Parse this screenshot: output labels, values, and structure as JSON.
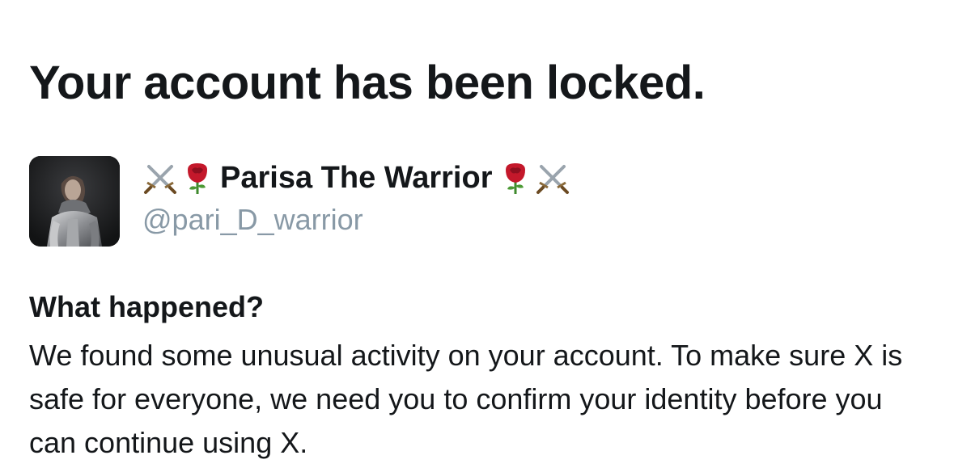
{
  "header": {
    "title": "Your account has been locked."
  },
  "profile": {
    "display_name": "Parisa The Warrior",
    "handle": "@pari_D_warrior",
    "name_emojis_left": [
      "crossed-swords",
      "rose"
    ],
    "name_emojis_right": [
      "rose",
      "crossed-swords"
    ]
  },
  "notice": {
    "heading": "What happened?",
    "body": "We found some unusual activity on your account. To make sure X is safe for everyone, we need you to confirm your identity before you can continue using X."
  },
  "colors": {
    "text_primary": "#14171a",
    "text_secondary": "#8899a6",
    "background": "#ffffff"
  }
}
